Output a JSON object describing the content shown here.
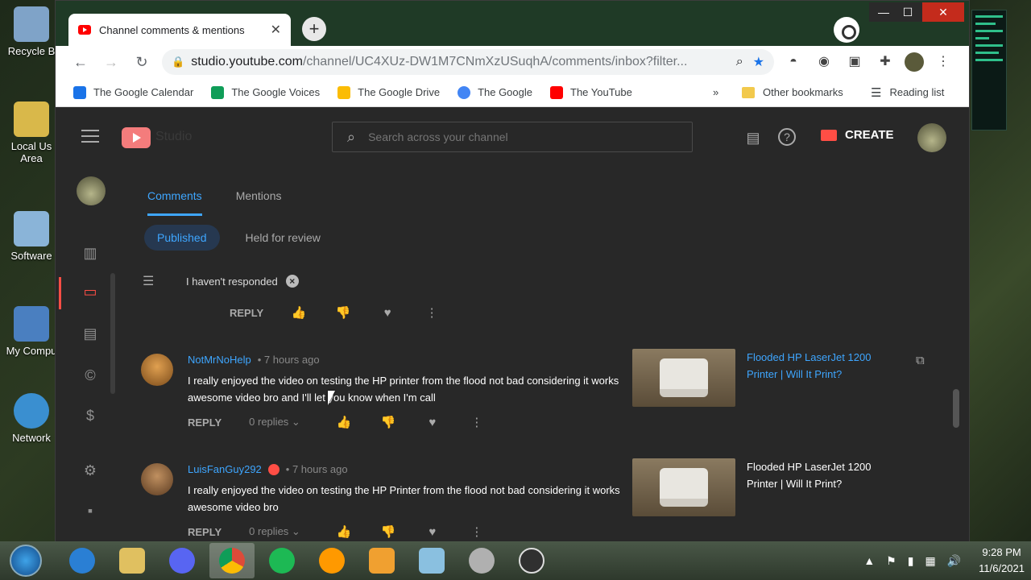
{
  "desktop": {
    "icons": [
      {
        "label": "Recycle B",
        "color": "#7fa3c8"
      },
      {
        "label": "Local Us Area",
        "color": "#d9b84a"
      },
      {
        "label": "Software",
        "color": "#8ab4d8"
      },
      {
        "label": "My Compu",
        "color": "#4a7fc0"
      },
      {
        "label": "Network",
        "color": "#3a8fd0"
      }
    ]
  },
  "browser": {
    "tab_title": "Channel comments & mentions",
    "tab_close": "✕",
    "new_tab": "+",
    "window_controls": {
      "minimize": "—",
      "maximize": "☐",
      "close": "✕"
    },
    "nav": {
      "back": "←",
      "forward": "→",
      "reload": "↻"
    },
    "url_host": "studio.youtube.com",
    "url_path": "/channel/UC4XUz-DW1M7CNmXzUSuqhA/comments/inbox?filter...",
    "bookmarks": [
      {
        "label": "The Google Calendar",
        "color": "#1a73e8"
      },
      {
        "label": "The Google Voices",
        "color": "#0f9d58"
      },
      {
        "label": "The Google Drive",
        "color": "#fbbc04"
      },
      {
        "label": "The Google",
        "color": "#4285f4"
      },
      {
        "label": "The YouTube",
        "color": "#ff0000"
      }
    ],
    "bookmarks_overflow": "»",
    "other_bookmarks": "Other bookmarks",
    "reading_list": "Reading list"
  },
  "studio": {
    "logo_text": "Studio",
    "search_placeholder": "Search across your channel",
    "create_label": "CREATE",
    "tabs": [
      {
        "label": "Comments",
        "active": true
      },
      {
        "label": "Mentions",
        "active": false
      }
    ],
    "subtabs": [
      {
        "label": "Published",
        "active": true
      },
      {
        "label": "Held for review",
        "active": false
      }
    ],
    "filter_chip": "I haven't responded",
    "top_actions": {
      "reply": "REPLY"
    },
    "comments": [
      {
        "author": "NotMrNoHelp",
        "time": "7 hours ago",
        "badge": false,
        "text": "I really enjoyed the video on testing the HP printer from the flood not bad considering it works awesome video bro and I'll let you know when I'm call",
        "reply": "REPLY",
        "replies": "0 replies",
        "video_title": "Flooded HP LaserJet 1200 Printer | Will It Print?",
        "avatar_color": "#c9802f"
      },
      {
        "author": "LuisFanGuy292",
        "time": "7 hours ago",
        "badge": true,
        "text": "I really enjoyed the video on testing the HP Printer from the flood not bad considering it works awesome video bro",
        "reply": "REPLY",
        "replies": "0 replies",
        "video_title": "Flooded HP LaserJet 1200 Printer | Will It Print?",
        "avatar_color": "#a0703a"
      }
    ]
  },
  "taskbar": {
    "apps": [
      {
        "name": "internet-explorer",
        "color": "#2a7fd4"
      },
      {
        "name": "file-explorer",
        "color": "#e0c060"
      },
      {
        "name": "discord",
        "color": "#5865f2"
      },
      {
        "name": "chrome",
        "color": "#dd4b39"
      },
      {
        "name": "spotify",
        "color": "#1db954"
      },
      {
        "name": "aol",
        "color": "#ff9900"
      },
      {
        "name": "outlook",
        "color": "#f0a030"
      },
      {
        "name": "notepad",
        "color": "#8ac0e0"
      },
      {
        "name": "network-tool",
        "color": "#b0b0b0"
      },
      {
        "name": "obs",
        "color": "#303030"
      }
    ],
    "time": "9:28 PM",
    "date": "11/6/2021"
  }
}
